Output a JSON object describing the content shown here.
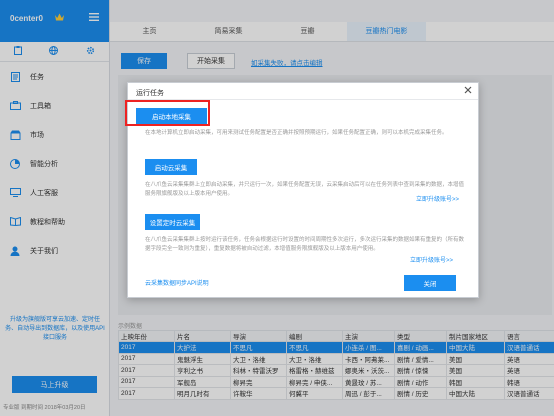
{
  "sidebar": {
    "brand": "0center0",
    "nav": [
      {
        "label": "任务",
        "icon": "task-icon"
      },
      {
        "label": "工具箱",
        "icon": "toolbox-icon"
      },
      {
        "label": "市场",
        "icon": "market-icon"
      },
      {
        "label": "智能分析",
        "icon": "analysis-icon"
      },
      {
        "label": "人工客服",
        "icon": "support-icon"
      },
      {
        "label": "教程和帮助",
        "icon": "help-icon"
      },
      {
        "label": "关于我们",
        "icon": "about-icon"
      }
    ],
    "promo": "升级为旗舰版可享云加速、定时任务、自动导出到数据库，以及使用API接口服务",
    "upgrade_label": "马上升级",
    "footer": "专业版 到期时间 2018年03月20日"
  },
  "tabs": [
    {
      "label": "主页",
      "active": false
    },
    {
      "label": "简易采集",
      "active": false
    },
    {
      "label": "豆瓣",
      "active": false
    },
    {
      "label": "豆瓣热门电影",
      "active": true
    }
  ],
  "toolbar": {
    "save_label": "保存",
    "start_label": "开始采集",
    "link_label": "如采集失败，请点击编辑"
  },
  "modal": {
    "title": "运行任务",
    "local_btn": "启动本地采集",
    "local_desc": "在本地计算机立即启动采集，可用来测试任务配置是否正确并按照预期运行，如果任务配置正确，则可以本机完成采集任务。",
    "cloud_btn": "启动云采集",
    "cloud_desc": "在八爪鱼云采集集群上立即启动采集，并只运行一次，如果任务配置无误，云采集启动后可以在任务列表中查到采集的数据，本增值服务限旗舰版及以上版本用户使用。",
    "timed_btn": "设置定时云采集",
    "timed_desc": "在八爪鱼云采集集群上按时运行该任务，任务会根据运行时设置的时间周期性多次运行，多次运行采集的数据如果有重复的（所有数据字段完全一致则为重复），重复数据将被自动过滤，本增值服务限旗舰版及以上版本用户使用。",
    "upgrade_link": "立即升级账号>>",
    "api_link": "云采集数据同步API说明",
    "close_label": "关闭"
  },
  "table": {
    "label": "示例数据",
    "headers": [
      "上映年份",
      "片名",
      "导演",
      "编剧",
      "主演",
      "类型",
      "制片国家地区",
      "语言"
    ],
    "rows": [
      [
        "2017",
        "大护法",
        "不思凡",
        "不思凡",
        "小连杀 / 图...",
        "喜剧 / 动画...",
        "中国大陆",
        "汉语普通话"
      ],
      [
        "2017",
        "鬼魅浮生",
        "大卫・洛维",
        "大卫・洛维",
        "卡西・阿弗莱...",
        "剧情 / 爱情...",
        "美国",
        "英语"
      ],
      [
        "2017",
        "亨利之书",
        "科林・特雷沃罗",
        "格雷格・赫维兹",
        "娜奥米・沃茨...",
        "剧情 / 惊悚",
        "美国",
        "英语"
      ],
      [
        "2017",
        "军舰岛",
        "柳昇完",
        "柳昇完 / 申侠...",
        "黄晸玟 / 苏...",
        "剧情 / 动作",
        "韩国",
        "韩语"
      ],
      [
        "2017",
        "明月几时有",
        "许鞍华",
        "何冀平",
        "周迅 / 彭于...",
        "剧情 / 历史",
        "中国大陆",
        "汉语普通话"
      ]
    ],
    "selected_row": 0
  }
}
